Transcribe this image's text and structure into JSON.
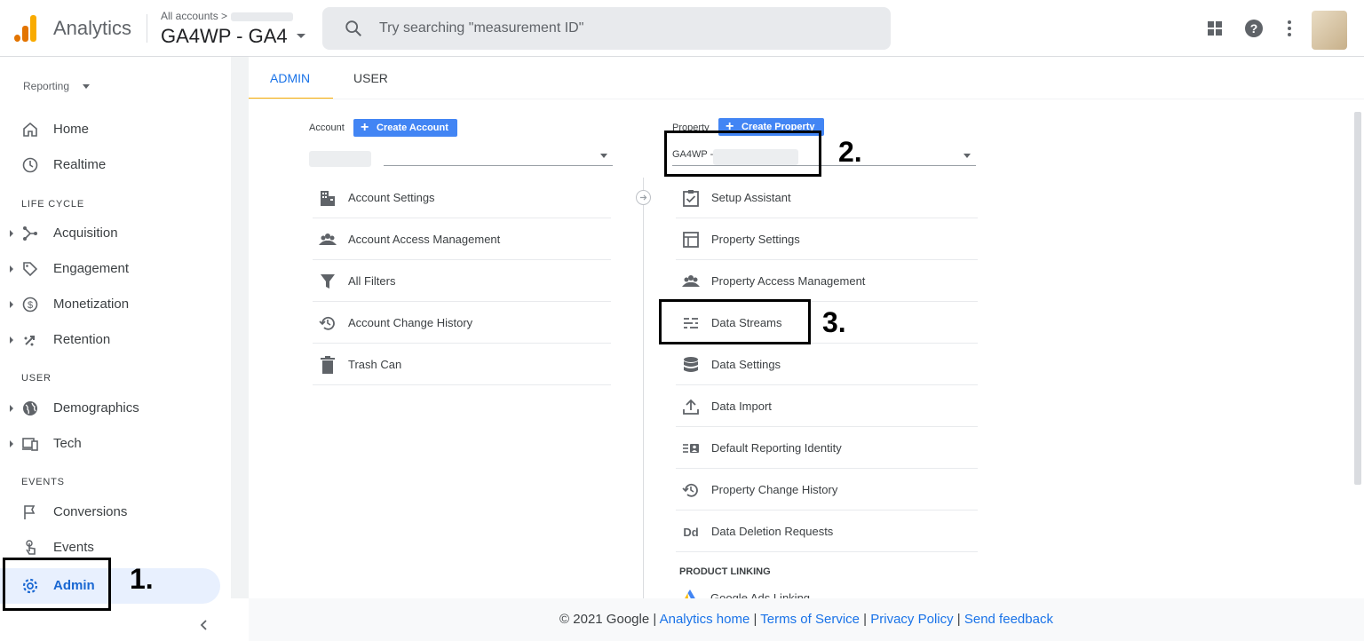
{
  "header": {
    "app_name": "Analytics",
    "breadcrumb": "All accounts >",
    "property_title": "GA4WP - GA4",
    "search_placeholder": "Try searching \"measurement ID\"",
    "icons": [
      "apps-icon",
      "help-icon",
      "more-vert-icon",
      "avatar"
    ]
  },
  "leftnav": {
    "reporting": "Reporting",
    "items": {
      "home": "Home",
      "realtime": "Realtime",
      "section_lifecycle": "LIFE CYCLE",
      "acquisition": "Acquisition",
      "engagement": "Engagement",
      "monetization": "Monetization",
      "retention": "Retention",
      "section_user": "USER",
      "demographics": "Demographics",
      "tech": "Tech",
      "section_events": "EVENTS",
      "conversions": "Conversions",
      "events": "Events",
      "admin": "Admin"
    }
  },
  "tabs": {
    "admin": "ADMIN",
    "user": "USER"
  },
  "account": {
    "label": "Account",
    "create_button": "Create Account",
    "items": [
      "Account Settings",
      "Account Access Management",
      "All Filters",
      "Account Change History",
      "Trash Can"
    ]
  },
  "property": {
    "label": "Property",
    "create_button": "Create Property",
    "selected": "GA4WP -",
    "items": [
      "Setup Assistant",
      "Property Settings",
      "Property Access Management",
      "Data Streams",
      "Data Settings",
      "Data Import",
      "Default Reporting Identity",
      "Property Change History",
      "Data Deletion Requests"
    ],
    "product_linking": "PRODUCT LINKING",
    "ads_linking": "Google Ads Linking"
  },
  "annotations": {
    "one": "1.",
    "two": "2.",
    "three": "3."
  },
  "footer": {
    "copyright": "© 2021 Google |",
    "analytics_home": "Analytics home",
    "sep1": "|",
    "terms": "Terms of Service",
    "sep2": "|",
    "privacy": "Privacy Policy",
    "sep3": "|",
    "feedback": "Send feedback"
  },
  "colors": {
    "accent": "#1a73e8",
    "brand_orange": "#f9ab00",
    "button_blue": "#4285f4"
  }
}
